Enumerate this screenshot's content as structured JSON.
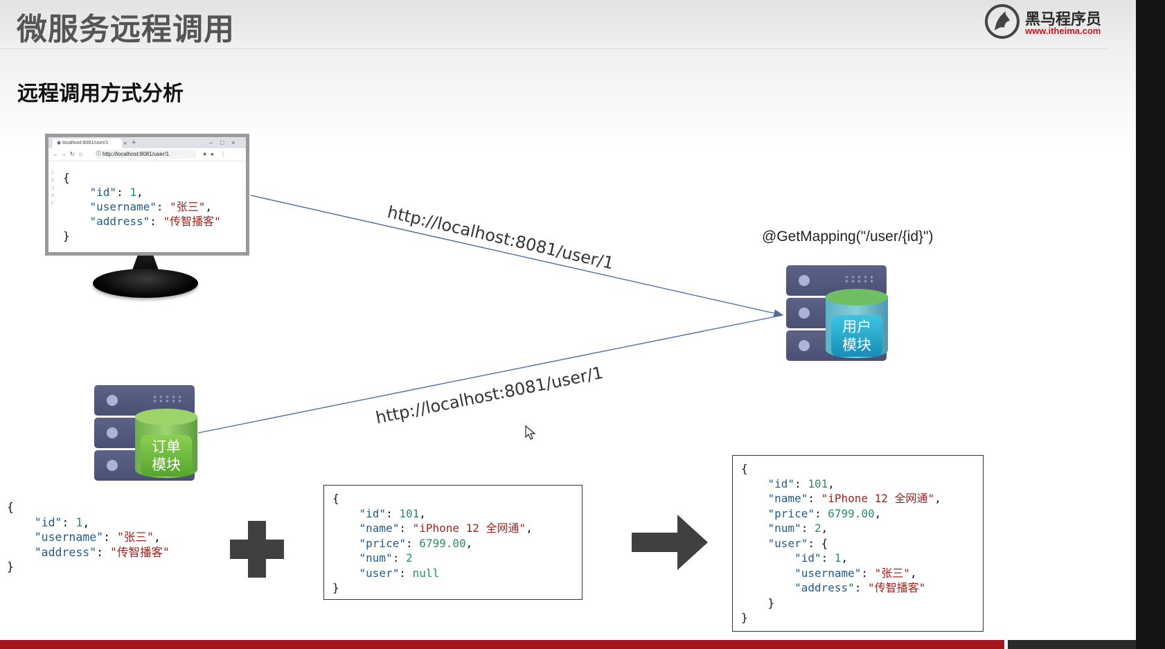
{
  "slide": {
    "title": "微服务远程调用",
    "subtitle": "远程调用方式分析",
    "logo": {
      "name_cn": "黑马程序员",
      "url_text": "www.itheima.com",
      "brand_color": "#c0161b"
    }
  },
  "browser": {
    "tab_title": "localhost:8081/user/1",
    "tab_close": "×",
    "new_tab": "+",
    "window_controls": [
      "–",
      "□",
      "×"
    ],
    "address": "http://localhost:8081/user/1",
    "line_numbers": "1\n2\n3\n4\n5",
    "icons": [
      "back-arrow-icon",
      "forward-arrow-icon",
      "reload-icon",
      "home-icon",
      "site-info-icon",
      "star-icon",
      "profile-icon",
      "menu-icon"
    ]
  },
  "user_response": {
    "open": "{",
    "id_key": "\"id\"",
    "id_val": "1",
    "username_key": "\"username\"",
    "username_val": "\"张三\"",
    "address_key": "\"address\"",
    "address_val": "\"传智播客\"",
    "close": "}"
  },
  "user_service": {
    "mapping": "@GetMapping(\"/user/{id}\")",
    "label_line1": "用户",
    "label_line2": "模块"
  },
  "order_service": {
    "label_line1": "订单",
    "label_line2": "模块"
  },
  "requests": {
    "from_browser_url": "http://localhost:8081/user/1",
    "from_order_url": "http://localhost:8081/user/1"
  },
  "order_json": {
    "open": "{",
    "id_key": "\"id\"",
    "id_val": "101",
    "name_key": "\"name\"",
    "name_val": "\"iPhone 12 全网通\"",
    "price_key": "\"price\"",
    "price_val": "6799.00",
    "num_key": "\"num\"",
    "num_val": "2",
    "user_key": "\"user\"",
    "user_val": "null",
    "close": "}"
  },
  "merged_json": {
    "open": "{",
    "id_key": "\"id\"",
    "id_val": "101",
    "name_key": "\"name\"",
    "name_val": "\"iPhone 12 全网通\"",
    "price_key": "\"price\"",
    "price_val": "6799.00",
    "num_key": "\"num\"",
    "num_val": "2",
    "user_key": "\"user\"",
    "user_open": "{",
    "u_id_key": "\"id\"",
    "u_id_val": "1",
    "u_username_key": "\"username\"",
    "u_username_val": "\"张三\"",
    "u_address_key": "\"address\"",
    "u_address_val": "\"传智播客\"",
    "user_close": "}",
    "close": "}"
  },
  "colors": {
    "json_key": "#1f5a8f",
    "json_number": "#2a8a6d",
    "json_string": "#a3211c",
    "arrow_line": "#4a6f9b",
    "footer_bar": "#a3161c"
  }
}
